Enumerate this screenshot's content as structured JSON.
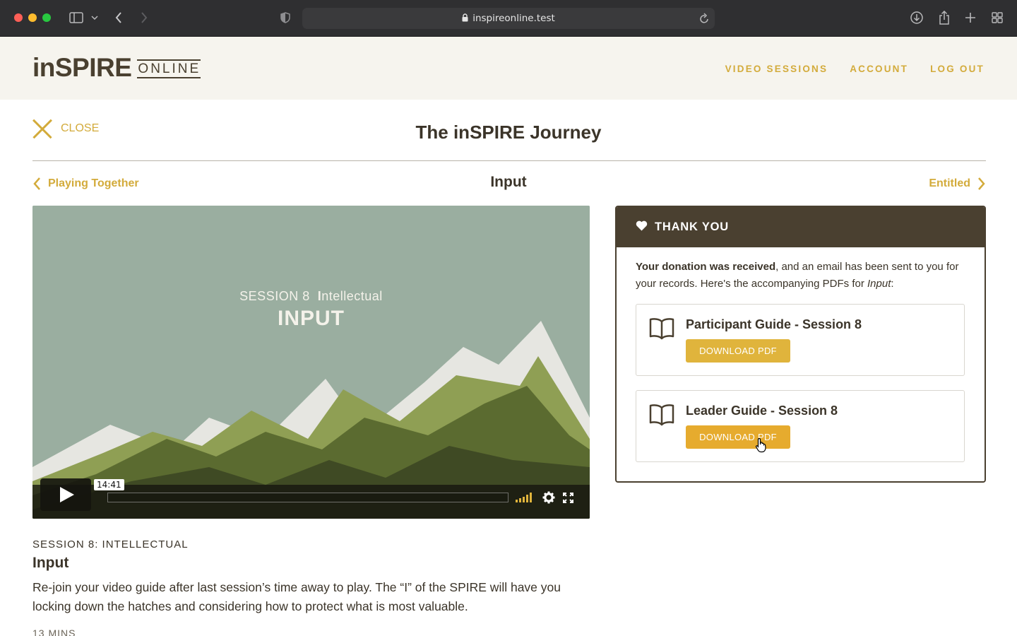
{
  "browser": {
    "url": "inspireonline.test"
  },
  "header": {
    "logo_main": "inSPIRE",
    "logo_sub": "ONLINE",
    "nav": [
      "VIDEO SESSIONS",
      "ACCOUNT",
      "LOG OUT"
    ]
  },
  "page": {
    "close_label": "CLOSE",
    "title": "The inSPIRE Journey",
    "prev_label": "Playing Together",
    "next_label": "Entitled",
    "session_title": "Input"
  },
  "video": {
    "overlay_session": "SESSION 8",
    "overlay_category_initial": "I",
    "overlay_category_rest": "ntellectual",
    "overlay_title": "INPUT",
    "time": "14:41",
    "bg_color": "#9aaea0",
    "accent": "#e0b43c"
  },
  "description": {
    "kicker": "SESSION 8: INTELLECTUAL",
    "title": "Input",
    "body": "Re-join your video guide after last session’s time away to play. The “I” of the SPIRE will have you locking down the hatches and considering how to protect what is most valuable.",
    "duration": "13 MINS"
  },
  "thank_you": {
    "heading": "THANK YOU",
    "message_bold": "Your donation was received",
    "message_rest": ", and an email has been sent to you for your records. Here's the accompanying PDFs for ",
    "message_italic": "Input",
    "message_end": ":",
    "pdfs": [
      {
        "title": "Participant Guide - Session 8",
        "button": "DOWNLOAD PDF"
      },
      {
        "title": "Leader Guide - Session 8",
        "button": "DOWNLOAD PDF"
      }
    ]
  },
  "colors": {
    "brand_dark": "#4a4030",
    "accent_gold": "#d3ab3b",
    "button_gold": "#e0b43c"
  }
}
